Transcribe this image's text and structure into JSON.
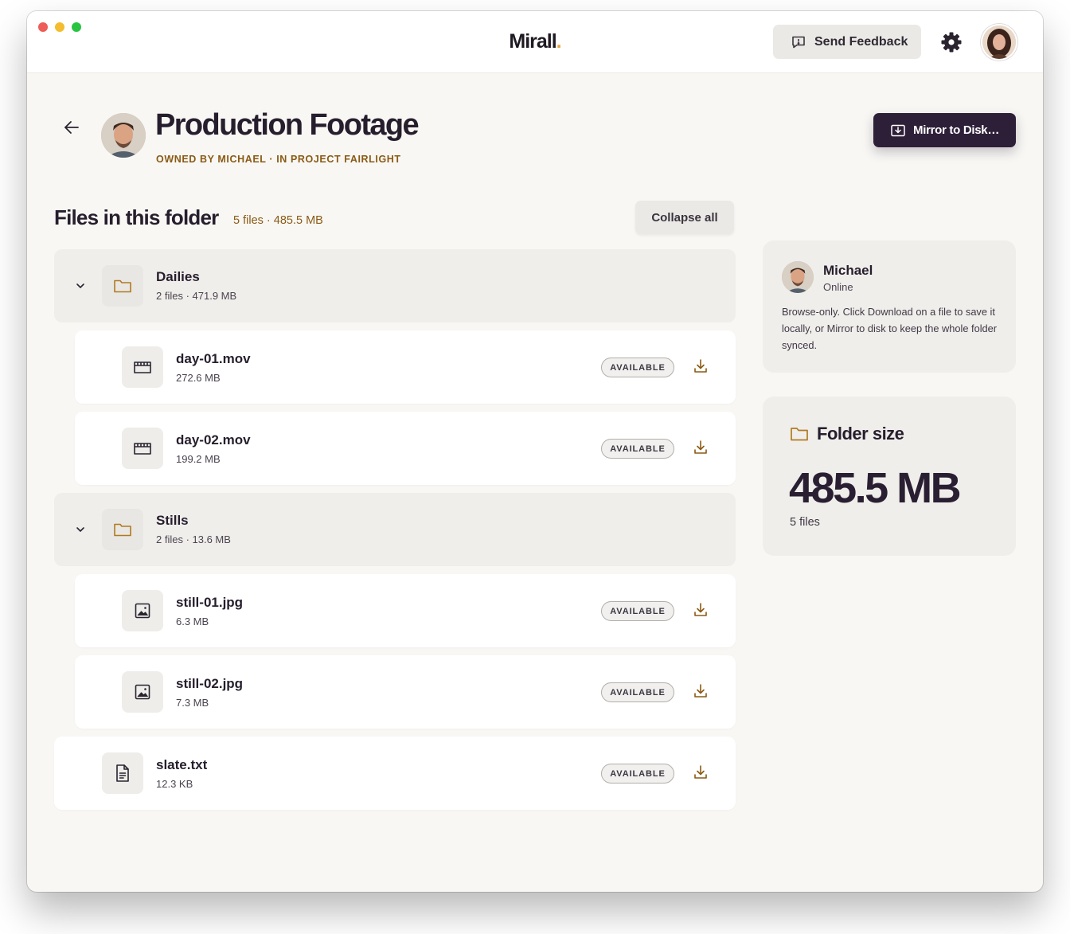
{
  "app": {
    "brand": "Mirall",
    "brand_dot": ".",
    "feedback_label": "Send Feedback"
  },
  "header": {
    "title": "Production Footage",
    "subtitle": "OWNED BY MICHAEL · IN PROJECT FAIRLIGHT",
    "mirror_label": "Mirror to Disk…"
  },
  "files_section": {
    "title": "Files in this folder",
    "meta": "5 files · 485.5 MB",
    "collapse_label": "Collapse all",
    "rows": [
      {
        "kind": "folder",
        "name": "Dailies",
        "meta": "2 files · 471.9 MB",
        "icon": "folder-icon"
      },
      {
        "kind": "file",
        "name": "day-01.mov",
        "meta": "272.6 MB",
        "status": "AVAILABLE",
        "icon": "video-icon"
      },
      {
        "kind": "file",
        "name": "day-02.mov",
        "meta": "199.2 MB",
        "status": "AVAILABLE",
        "icon": "video-icon"
      },
      {
        "kind": "folder",
        "name": "Stills",
        "meta": "2 files · 13.6 MB",
        "icon": "folder-icon"
      },
      {
        "kind": "file",
        "name": "still-01.jpg",
        "meta": "6.3 MB",
        "status": "AVAILABLE",
        "icon": "image-icon"
      },
      {
        "kind": "file",
        "name": "still-02.jpg",
        "meta": "7.3 MB",
        "status": "AVAILABLE",
        "icon": "image-icon"
      },
      {
        "kind": "file",
        "name": "slate.txt",
        "meta": "12.3 KB",
        "status": "AVAILABLE",
        "icon": "text-file-icon"
      }
    ]
  },
  "presence": {
    "name": "Michael",
    "status": "Online",
    "help": "Browse-only. Click Download on a file to save it locally, or Mirror to disk to keep the whole folder synced."
  },
  "folder_size": {
    "title": "Folder size",
    "value": "485.5 MB",
    "files": "5 files"
  },
  "colors": {
    "accent_dark": "#2e1f39",
    "accent_brown": "#8a5a14",
    "brand_dot": "#e8a443",
    "background": "#f8f7f4"
  }
}
